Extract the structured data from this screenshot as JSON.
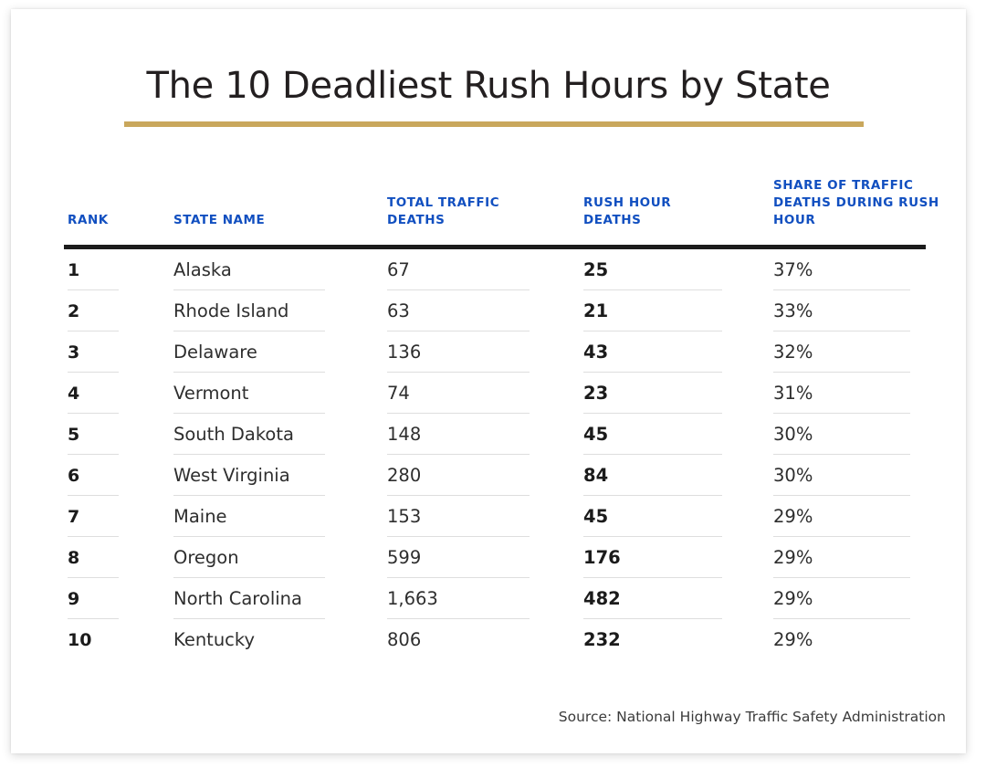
{
  "header": {
    "title": "The 10 Deadliest Rush Hours by State",
    "accent_rule_color": "#c9a75c"
  },
  "table": {
    "header_rule_color": "#1c1c1c",
    "header_text_color": "#114fc0",
    "columns": [
      {
        "key": "rank",
        "label": "RANK"
      },
      {
        "key": "state",
        "label": "STATE NAME"
      },
      {
        "key": "total",
        "label": "TOTAL TRAFFIC DEATHS"
      },
      {
        "key": "rush",
        "label": "RUSH HOUR DEATHS"
      },
      {
        "key": "share",
        "label": "SHARE OF TRAFFIC DEATHS DURING RUSH HOUR"
      }
    ],
    "rows": [
      {
        "rank": "1",
        "state": "Alaska",
        "total": "67",
        "rush": "25",
        "share": "37%"
      },
      {
        "rank": "2",
        "state": "Rhode Island",
        "total": "63",
        "rush": "21",
        "share": "33%"
      },
      {
        "rank": "3",
        "state": "Delaware",
        "total": "136",
        "rush": "43",
        "share": "32%"
      },
      {
        "rank": "4",
        "state": "Vermont",
        "total": "74",
        "rush": "23",
        "share": "31%"
      },
      {
        "rank": "5",
        "state": "South Dakota",
        "total": "148",
        "rush": "45",
        "share": "30%"
      },
      {
        "rank": "6",
        "state": "West Virginia",
        "total": "280",
        "rush": "84",
        "share": "30%"
      },
      {
        "rank": "7",
        "state": "Maine",
        "total": "153",
        "rush": "45",
        "share": "29%"
      },
      {
        "rank": "8",
        "state": "Oregon",
        "total": "599",
        "rush": "176",
        "share": "29%"
      },
      {
        "rank": "9",
        "state": "North Carolina",
        "total": "1,663",
        "rush": "482",
        "share": "29%"
      },
      {
        "rank": "10",
        "state": "Kentucky",
        "total": "806",
        "rush": "232",
        "share": "29%"
      }
    ]
  },
  "footer": {
    "source": "Source: National Highway Traffic Safety Administration"
  },
  "chart_data": {
    "type": "table",
    "title": "The 10 Deadliest Rush Hours by State",
    "columns": [
      "RANK",
      "STATE NAME",
      "TOTAL TRAFFIC DEATHS",
      "RUSH HOUR DEATHS",
      "SHARE OF TRAFFIC DEATHS DURING RUSH HOUR"
    ],
    "categories": [
      "Alaska",
      "Rhode Island",
      "Delaware",
      "Vermont",
      "South Dakota",
      "West Virginia",
      "Maine",
      "Oregon",
      "North Carolina",
      "Kentucky"
    ],
    "series": [
      {
        "name": "Total traffic deaths",
        "values": [
          67,
          63,
          136,
          74,
          148,
          280,
          153,
          599,
          1663,
          806
        ]
      },
      {
        "name": "Rush hour deaths",
        "values": [
          25,
          21,
          43,
          23,
          45,
          84,
          45,
          176,
          482,
          232
        ]
      },
      {
        "name": "Share of traffic deaths during rush hour (%)",
        "values": [
          37,
          33,
          32,
          31,
          30,
          30,
          29,
          29,
          29,
          29
        ]
      }
    ],
    "ranks": [
      1,
      2,
      3,
      4,
      5,
      6,
      7,
      8,
      9,
      10
    ],
    "source": "Source: National Highway Traffic Safety Administration"
  }
}
